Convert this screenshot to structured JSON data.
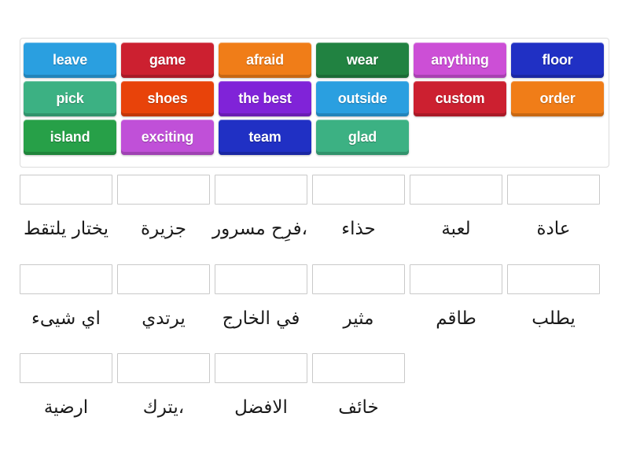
{
  "activity": {
    "type": "match-up",
    "columns": 6,
    "tile_text_color": "#ffffff",
    "dropzone_border_color": "#c9c9c9",
    "container_border_color": "#dcdcdc"
  },
  "tile_bank": {
    "rows": [
      [
        {
          "label": "leave",
          "color": "#2a9fe0"
        },
        {
          "label": "game",
          "color": "#cc2030"
        },
        {
          "label": "afraid",
          "color": "#f07d18"
        },
        {
          "label": "wear",
          "color": "#218241"
        },
        {
          "label": "anything",
          "color": "#cc4fd6"
        },
        {
          "label": "floor",
          "color": "#2030c4"
        }
      ],
      [
        {
          "label": "pick",
          "color": "#3cb183"
        },
        {
          "label": "shoes",
          "color": "#e8430a"
        },
        {
          "label": "the best",
          "color": "#8023d8"
        },
        {
          "label": "outside",
          "color": "#2a9fe0"
        },
        {
          "label": "custom",
          "color": "#cc2030"
        },
        {
          "label": "order",
          "color": "#f07d18"
        }
      ],
      [
        {
          "label": "island",
          "color": "#27a048"
        },
        {
          "label": "exciting",
          "color": "#c050d8"
        },
        {
          "label": "team",
          "color": "#2030c4"
        },
        {
          "label": "glad",
          "color": "#3cb183"
        },
        {
          "label": "",
          "color": ""
        },
        {
          "label": "",
          "color": ""
        }
      ]
    ]
  },
  "answer_rows": [
    {
      "cells": [
        {
          "prompt": "يختار يلتقط",
          "value": ""
        },
        {
          "prompt": "جزيرة",
          "value": ""
        },
        {
          "prompt": "،فرِح مسرور",
          "value": ""
        },
        {
          "prompt": "حذاء",
          "value": ""
        },
        {
          "prompt": "لعبة",
          "value": ""
        },
        {
          "prompt": "عادة",
          "value": ""
        }
      ]
    },
    {
      "cells": [
        {
          "prompt": "اي شيىء",
          "value": ""
        },
        {
          "prompt": "يرتدي",
          "value": ""
        },
        {
          "prompt": "في الخارج",
          "value": ""
        },
        {
          "prompt": "مثير",
          "value": ""
        },
        {
          "prompt": "طاقم",
          "value": ""
        },
        {
          "prompt": "يطلب",
          "value": ""
        }
      ]
    },
    {
      "cells": [
        {
          "prompt": "ارضية",
          "value": ""
        },
        {
          "prompt": "،يترك",
          "value": ""
        },
        {
          "prompt": "الافضل",
          "value": ""
        },
        {
          "prompt": "خائف",
          "value": ""
        },
        {
          "prompt": "",
          "value": "",
          "blank": true
        },
        {
          "prompt": "",
          "value": "",
          "blank": true
        }
      ]
    }
  ]
}
